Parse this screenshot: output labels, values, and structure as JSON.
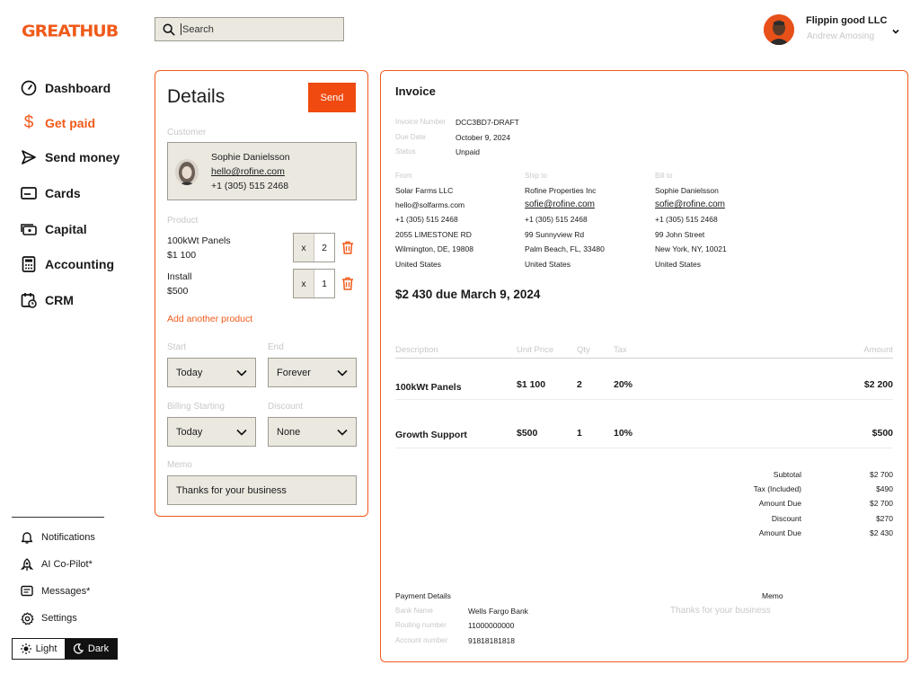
{
  "app": {
    "logo": "GREATHUB",
    "search_placeholder": "Search"
  },
  "user": {
    "company": "Flippin good LLC",
    "name": "Andrew Amosing"
  },
  "sidebar": {
    "items": [
      {
        "label": "Dashboard",
        "icon": "gauge-icon"
      },
      {
        "label": "Get paid",
        "icon": "dollar-icon",
        "active": true
      },
      {
        "label": "Send money",
        "icon": "paper-plane-icon"
      },
      {
        "label": "Cards",
        "icon": "card-icon"
      },
      {
        "label": "Capital",
        "icon": "capital-icon"
      },
      {
        "label": "Accounting",
        "icon": "calculator-icon"
      },
      {
        "label": "CRM",
        "icon": "calendar-icon"
      }
    ],
    "sub_items": [
      {
        "label": "Notifications",
        "icon": "bell-icon"
      },
      {
        "label": "AI Co-Pilot*",
        "icon": "rocket-icon"
      },
      {
        "label": "Messages*",
        "icon": "message-icon"
      },
      {
        "label": "Settings",
        "icon": "gear-icon"
      }
    ],
    "theme": {
      "light": "Light",
      "dark": "Dark"
    }
  },
  "details": {
    "title": "Details",
    "send_label": "Send",
    "customer_label": "Customer",
    "customer": {
      "name": "Sophie Danielsson",
      "email": "hello@rofine.com",
      "phone": "+1 (305) 515 2468"
    },
    "product_label": "Product",
    "products": [
      {
        "name": "100kWt Panels",
        "price": "$1 100",
        "qty_prefix": "x",
        "qty": "2"
      },
      {
        "name": "Install",
        "price": "$500",
        "qty_prefix": "x",
        "qty": "1"
      }
    ],
    "add_product": "Add another product",
    "start_label": "Start",
    "start_value": "Today",
    "end_label": "End",
    "end_value": "Forever",
    "billing_label": "Billing Starting",
    "billing_value": "Today",
    "discount_label": "Discount",
    "discount_value": "None",
    "memo_label": "Memo",
    "memo_value": "Thanks for your business"
  },
  "invoice": {
    "title": "Invoice",
    "meta": [
      {
        "label": "Invoice Number",
        "value": "DCC3BD7-DRAFT"
      },
      {
        "label": "Due Date",
        "value": "October 9, 2024"
      },
      {
        "label": "Status",
        "value": "Unpaid"
      }
    ],
    "from": {
      "label": "From",
      "lines": [
        "Solar Farms LLC",
        "hello@solfarms.com",
        "+1 (305) 515 2468",
        "2055 LIMESTONE RD",
        "Wilmington, DE, 19808",
        "United States"
      ]
    },
    "ship_to": {
      "label": "Ship to",
      "company": "Rofine Properties Inc",
      "email": "sofie@rofine.com",
      "lines": [
        "+1 (305) 515 2468",
        "99 Sunnyview Rd",
        "Palm Beach, FL, 33480",
        "United States"
      ]
    },
    "bill_to": {
      "label": "Bill to",
      "name": "Sophie Danielsson",
      "email": "sofie@rofine.com",
      "lines": [
        "+1 (305) 515 2468",
        "99 John Street",
        "New York, NY, 10021",
        "United States"
      ]
    },
    "due_summary": "$2 430 due March 9, 2024",
    "table_headers": {
      "description": "Description",
      "unit_price": "Unit Price",
      "qty": "Qty",
      "tax": "Tax",
      "amount": "Amount"
    },
    "rows": [
      {
        "description": "100kWt Panels",
        "unit_price": "$1 100",
        "qty": "2",
        "tax": "20%",
        "amount": "$2 200"
      },
      {
        "description": "Growth Support",
        "unit_price": "$500",
        "qty": "1",
        "tax": "10%",
        "amount": "$500"
      }
    ],
    "totals": [
      {
        "label": "Subtotal",
        "value": "$2 700"
      },
      {
        "label": "Tax (Included)",
        "value": "$490"
      },
      {
        "label": "Amount Due",
        "value": "$2 700"
      },
      {
        "label": "Discount",
        "value": "$270"
      },
      {
        "label": "Amount Due",
        "value": "$2 430"
      }
    ],
    "payment": {
      "title": "Payment Details",
      "rows": [
        {
          "label": "Bank Name",
          "value": "Wells Fargo Bank"
        },
        {
          "label": "Routing number",
          "value": "11000000000"
        },
        {
          "label": "Account number",
          "value": "91818181818"
        }
      ]
    },
    "memo_title": "Memo",
    "memo_text": "Thanks for your business"
  },
  "colors": {
    "accent": "#f05a1a",
    "field_bg": "#ebe8e0",
    "border": "#9e9b93"
  }
}
